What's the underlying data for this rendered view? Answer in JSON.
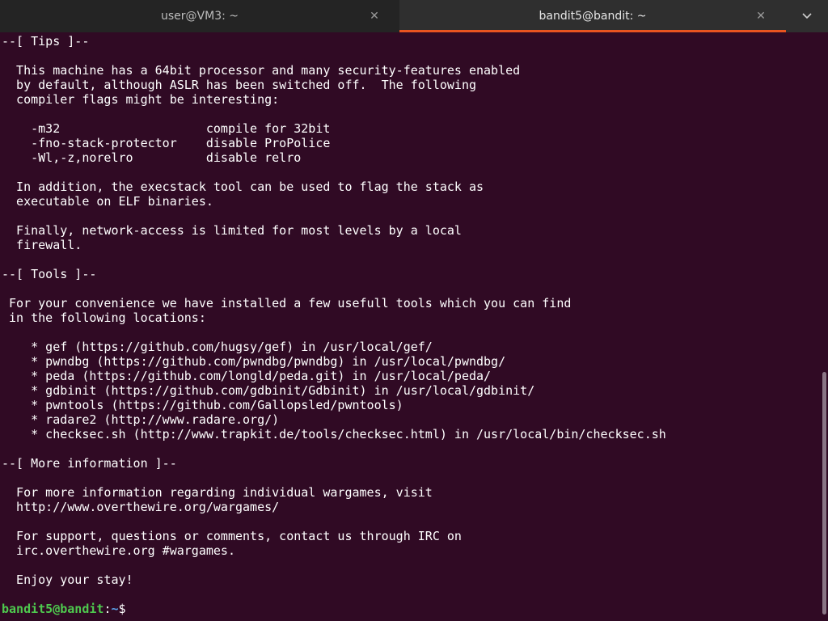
{
  "tabs": [
    {
      "title": "user@VM3: ~",
      "active": false
    },
    {
      "title": "bandit5@bandit: ~",
      "active": true
    }
  ],
  "icons": {
    "close": "close-icon",
    "menu": "chevron-down-icon"
  },
  "colors": {
    "terminal_bg": "#300a24",
    "text": "#ffffff",
    "prompt_user": "#4ec94e",
    "prompt_path": "#5aa0e8",
    "active_tab_underline": "#e95420"
  },
  "terminal": {
    "lines": [
      "--[ Tips ]--",
      "",
      "  This machine has a 64bit processor and many security-features enabled",
      "  by default, although ASLR has been switched off.  The following",
      "  compiler flags might be interesting:",
      "",
      "    -m32                    compile for 32bit",
      "    -fno-stack-protector    disable ProPolice",
      "    -Wl,-z,norelro          disable relro",
      "",
      "  In addition, the execstack tool can be used to flag the stack as",
      "  executable on ELF binaries.",
      "",
      "  Finally, network-access is limited for most levels by a local",
      "  firewall.",
      "",
      "--[ Tools ]--",
      "",
      " For your convenience we have installed a few usefull tools which you can find",
      " in the following locations:",
      "",
      "    * gef (https://github.com/hugsy/gef) in /usr/local/gef/",
      "    * pwndbg (https://github.com/pwndbg/pwndbg) in /usr/local/pwndbg/",
      "    * peda (https://github.com/longld/peda.git) in /usr/local/peda/",
      "    * gdbinit (https://github.com/gdbinit/Gdbinit) in /usr/local/gdbinit/",
      "    * pwntools (https://github.com/Gallopsled/pwntools)",
      "    * radare2 (http://www.radare.org/)",
      "    * checksec.sh (http://www.trapkit.de/tools/checksec.html) in /usr/local/bin/checksec.sh",
      "",
      "--[ More information ]--",
      "",
      "  For more information regarding individual wargames, visit",
      "  http://www.overthewire.org/wargames/",
      "",
      "  For support, questions or comments, contact us through IRC on",
      "  irc.overthewire.org #wargames.",
      "",
      "  Enjoy your stay!",
      ""
    ],
    "prompt": {
      "user_host": "bandit5@bandit",
      "separator": ":",
      "path": "~",
      "symbol": "$ "
    }
  }
}
